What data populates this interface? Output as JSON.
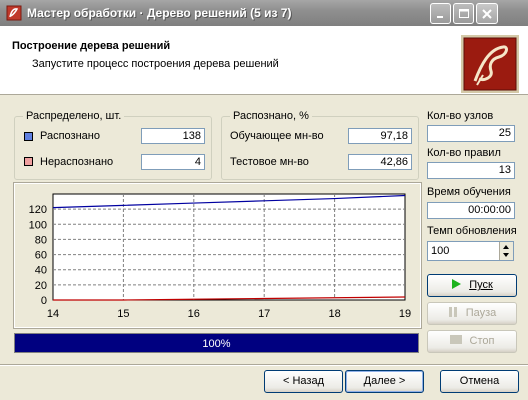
{
  "window": {
    "title": "Мастер обработки · Дерево решений (5 из 7)"
  },
  "header": {
    "title": "Построение дерева решений",
    "subtitle": "Запустите процесс построения дерева решений"
  },
  "distributed": {
    "label": "Распределено, шт.",
    "recognized_label": "Распознано",
    "recognized_value": "138",
    "unrecognized_label": "Нераспознано",
    "unrecognized_value": "4"
  },
  "recognized_pct": {
    "label": "Распознано, %",
    "training_label": "Обучающее мн-во",
    "training_value": "97,18",
    "test_label": "Тестовое мн-во",
    "test_value": "42,86"
  },
  "stats": {
    "nodes_label": "Кол-во узлов",
    "nodes_value": "25",
    "rules_label": "Кол-во правил",
    "rules_value": "13",
    "time_label": "Время обучения",
    "time_value": "00:00:00",
    "rate_label": "Темп обновления",
    "rate_value": "100"
  },
  "controls": {
    "start": "Пуск",
    "pause": "Пауза",
    "stop": "Стоп"
  },
  "progress": {
    "fraction": 1.0,
    "text": "100%"
  },
  "nav": {
    "back": "< Назад",
    "next": "Далее >",
    "cancel": "Отмена"
  },
  "colors": {
    "recognized": "#0000a0",
    "unrecognized": "#c00000",
    "start_icon": "#1db31d"
  },
  "chart_data": {
    "type": "line",
    "x": [
      14,
      15,
      16,
      17,
      18,
      19
    ],
    "xlim": [
      14,
      19
    ],
    "ylim": [
      0,
      140
    ],
    "x_ticks": [
      "14",
      "15",
      "16",
      "17",
      "18",
      "19"
    ],
    "y_ticks": [
      "0",
      "20",
      "40",
      "60",
      "80",
      "100",
      "120"
    ],
    "grid": true,
    "series": [
      {
        "name": "Распознано",
        "color": "#0000a0",
        "values": [
          122,
          125,
          128,
          131,
          134,
          138
        ]
      },
      {
        "name": "Нераспознано",
        "color": "#c00000",
        "values": [
          0,
          0,
          1,
          2,
          3,
          4
        ]
      }
    ]
  }
}
